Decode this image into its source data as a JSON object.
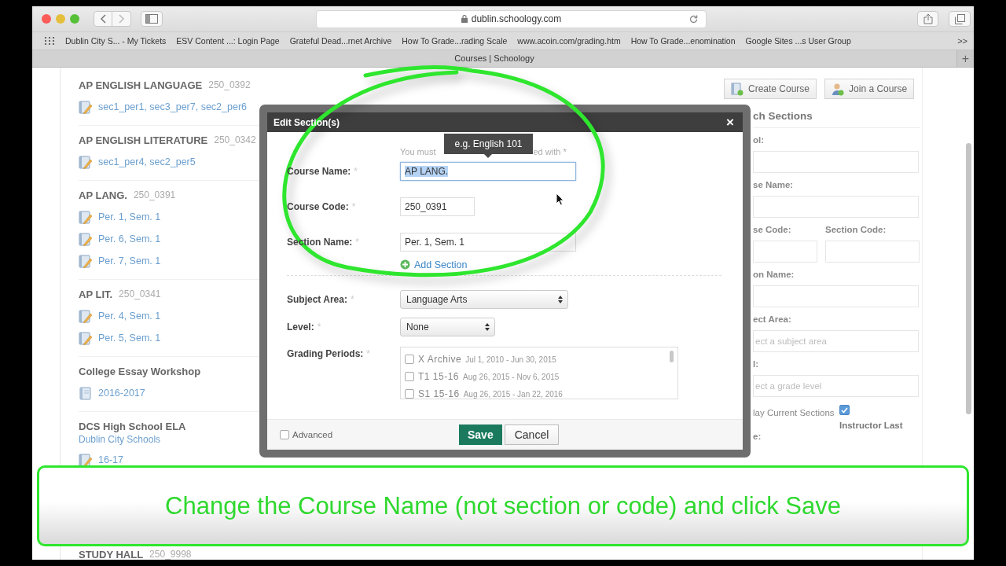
{
  "browser": {
    "url": "dublin.schoology.com",
    "bookmarks": [
      "Dublin City S... - My Tickets",
      "ESV Content ...: Login Page",
      "Grateful Dead...rnet Archive",
      "How To Grade...rading Scale",
      "www.acoin.com/grading.htm",
      "How To Grade...enomination",
      "Google Sites ...s User Group"
    ],
    "more": ">>",
    "tab_title": "Courses | Schoology",
    "new_tab": "+"
  },
  "courses": [
    {
      "title": "AP ENGLISH LANGUAGE",
      "code": "250_0392",
      "sections": [
        {
          "label": "sec1_per1, sec3_per7, sec2_per6",
          "kind": "edit"
        }
      ]
    },
    {
      "title": "AP ENGLISH LITERATURE",
      "code": "250_0342",
      "sections": [
        {
          "label": "sec1_per4, sec2_per5",
          "kind": "edit"
        }
      ]
    },
    {
      "title": "AP LANG.",
      "code": "250_0391",
      "sections": [
        {
          "label": "Per. 1, Sem. 1",
          "kind": "edit"
        },
        {
          "label": "Per. 6, Sem. 1",
          "kind": "edit"
        },
        {
          "label": "Per. 7, Sem. 1",
          "kind": "edit"
        }
      ]
    },
    {
      "title": "AP LIT.",
      "code": "250_0341",
      "sections": [
        {
          "label": "Per. 4, Sem. 1",
          "kind": "edit"
        },
        {
          "label": "Per. 5, Sem. 1",
          "kind": "edit"
        }
      ]
    },
    {
      "title": "College Essay Workshop",
      "sections": [
        {
          "label": "2016-2017",
          "kind": "plain"
        }
      ]
    },
    {
      "title": "DCS High School ELA",
      "school": "Dublin City Schools",
      "sections": [
        {
          "label": "16-17",
          "kind": "edit"
        }
      ]
    },
    {
      "title": "STUDY HALL",
      "code": "250_9998"
    }
  ],
  "side_panel": {
    "buttons": [
      {
        "label": "Create Course",
        "kind": "create"
      },
      {
        "label": "Join a Course",
        "kind": "join"
      }
    ],
    "heading": "ch Sections",
    "school_label": "ol:",
    "course_name_label": "se Name:",
    "course_code_label": "se Code:",
    "section_code_label": "Section Code:",
    "section_name_label": "on Name:",
    "subject_label": "ect Area:",
    "subject_placeholder": "ect a subject area",
    "level_label": "l:",
    "level_placeholder": "ect a grade level",
    "current_label": "lay Current Sections",
    "current_checked": true,
    "instructor_label": "Instructor Last",
    "sort_label": "e:"
  },
  "dialog": {
    "title": "Edit Section(s)",
    "close": "×",
    "required_mark": "*",
    "hint_start": "You must",
    "hint_end": "ed with *",
    "tooltip": "e.g. English 101",
    "fields": [
      {
        "label": "Course Name:",
        "value": "AP LANG.",
        "kind": "wide",
        "selected": true
      },
      {
        "label": "Course Code:",
        "value": "250_0391",
        "kind": "short",
        "selected": false
      },
      {
        "label": "Section Name:",
        "value": "Per. 1, Sem. 1",
        "kind": "wide",
        "selected": false
      }
    ],
    "add_section": "Add Section",
    "selects": [
      {
        "label": "Subject Area:",
        "value": "Language Arts",
        "kind": "wide"
      },
      {
        "label": "Level:",
        "value": "None",
        "kind": "short"
      }
    ],
    "grading_label": "Grading Periods:",
    "grading_periods": [
      {
        "name": "X Archive",
        "dates": "Jul 1, 2010 - Jun 30, 2015",
        "checked": false
      },
      {
        "name": "T1 15-16",
        "dates": "Aug 26, 2015 - Nov 6, 2015",
        "checked": false
      },
      {
        "name": "S1 15-16",
        "dates": "Aug 26, 2015 - Jan 22, 2016",
        "checked": false
      }
    ],
    "advanced": {
      "label": "Advanced",
      "checked": false
    },
    "buttons": [
      {
        "label": "Save",
        "kind": "primary"
      },
      {
        "label": "Cancel",
        "kind": "secondary"
      }
    ]
  },
  "caption": "Change the Course Name (not section or code) and click Save"
}
